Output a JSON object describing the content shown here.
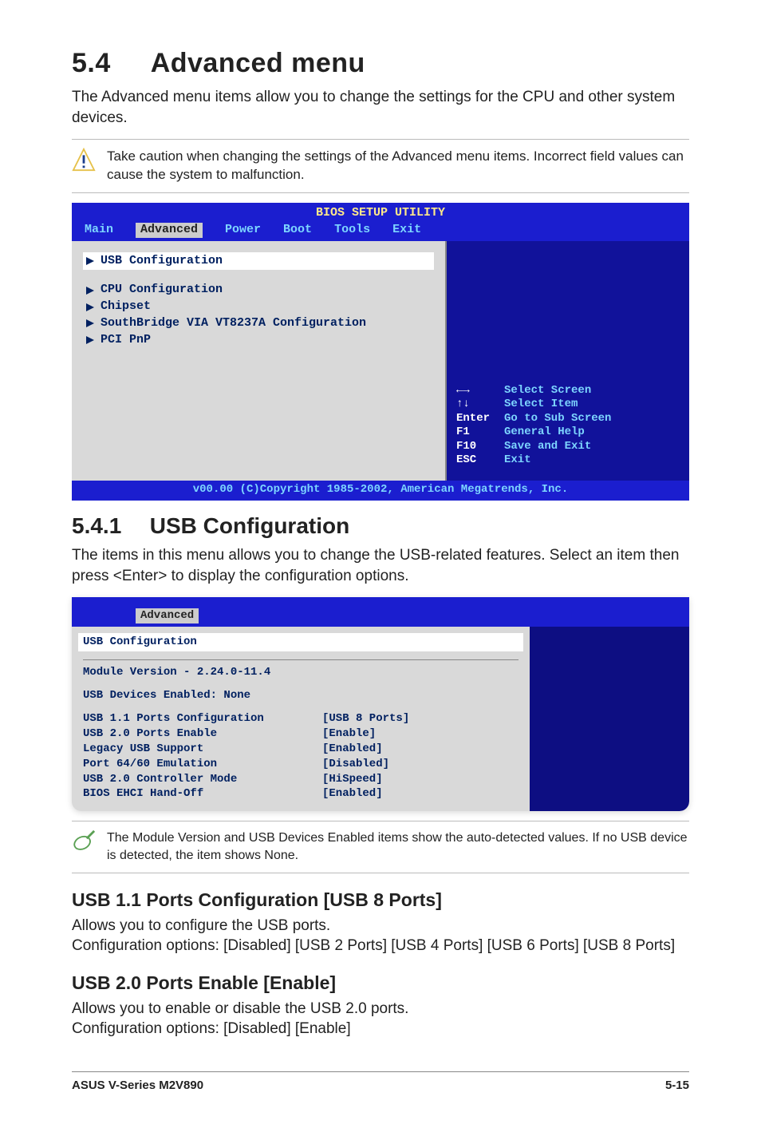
{
  "heading": {
    "number": "5.4",
    "title": "Advanced menu"
  },
  "intro": "The Advanced menu items allow you to change the settings for the CPU and other system devices.",
  "caution": "Take caution when changing the settings of the Advanced menu items. Incorrect field values can cause the system to malfunction.",
  "bios1": {
    "title": "BIOS SETUP UTILITY",
    "tabs": [
      "Main",
      "Advanced",
      "Power",
      "Boot",
      "Tools",
      "Exit"
    ],
    "activeTab": "Advanced",
    "menu": [
      "USB Configuration",
      "CPU Configuration",
      "Chipset",
      "SouthBridge VIA VT8237A Configuration",
      "PCI PnP"
    ],
    "help": [
      {
        "key": "←→",
        "text": "Select Screen"
      },
      {
        "key": "↑↓",
        "text": "Select Item"
      },
      {
        "key": "Enter",
        "text": "Go to Sub Screen"
      },
      {
        "key": "F1",
        "text": "General Help"
      },
      {
        "key": "F10",
        "text": "Save and Exit"
      },
      {
        "key": "ESC",
        "text": "Exit"
      }
    ],
    "footer": "v00.00 (C)Copyright 1985-2002, American Megatrends, Inc."
  },
  "subsection": {
    "number": "5.4.1",
    "title": "USB Configuration"
  },
  "subintro": "The items in this menu allows you to change the USB-related features. Select an item then press <Enter> to display the configuration options.",
  "bios2": {
    "activeTab": "Advanced",
    "header": "USB Configuration",
    "module": "Module Version - 2.24.0-11.4",
    "devices": "USB Devices Enabled: None",
    "rows": [
      {
        "label": "USB 1.1 Ports Configuration",
        "value": "[USB 8 Ports]"
      },
      {
        "label": "USB 2.0 Ports Enable",
        "value": "[Enable]"
      },
      {
        "label": "Legacy USB Support",
        "value": "[Enabled]"
      },
      {
        "label": "Port 64/60 Emulation",
        "value": "[Disabled]"
      },
      {
        "label": "USB 2.0 Controller Mode",
        "value": "[HiSpeed]"
      },
      {
        "label": "BIOS EHCI Hand-Off",
        "value": "[Enabled]"
      }
    ]
  },
  "note": "The Module Version and USB Devices Enabled items show the auto-detected values. If no USB device is detected, the item shows None.",
  "options": [
    {
      "title": "USB 1.1 Ports Configuration [USB 8 Ports]",
      "body": "Allows you to configure the USB ports.\nConfiguration options: [Disabled] [USB 2 Ports] [USB 4 Ports] [USB 6 Ports] [USB 8 Ports]"
    },
    {
      "title": "USB 2.0 Ports Enable [Enable]",
      "body": "Allows you to enable or disable the USB 2.0 ports.\nConfiguration options: [Disabled] [Enable]"
    }
  ],
  "footer": {
    "left": "ASUS V-Series M2V890",
    "right": "5-15"
  }
}
